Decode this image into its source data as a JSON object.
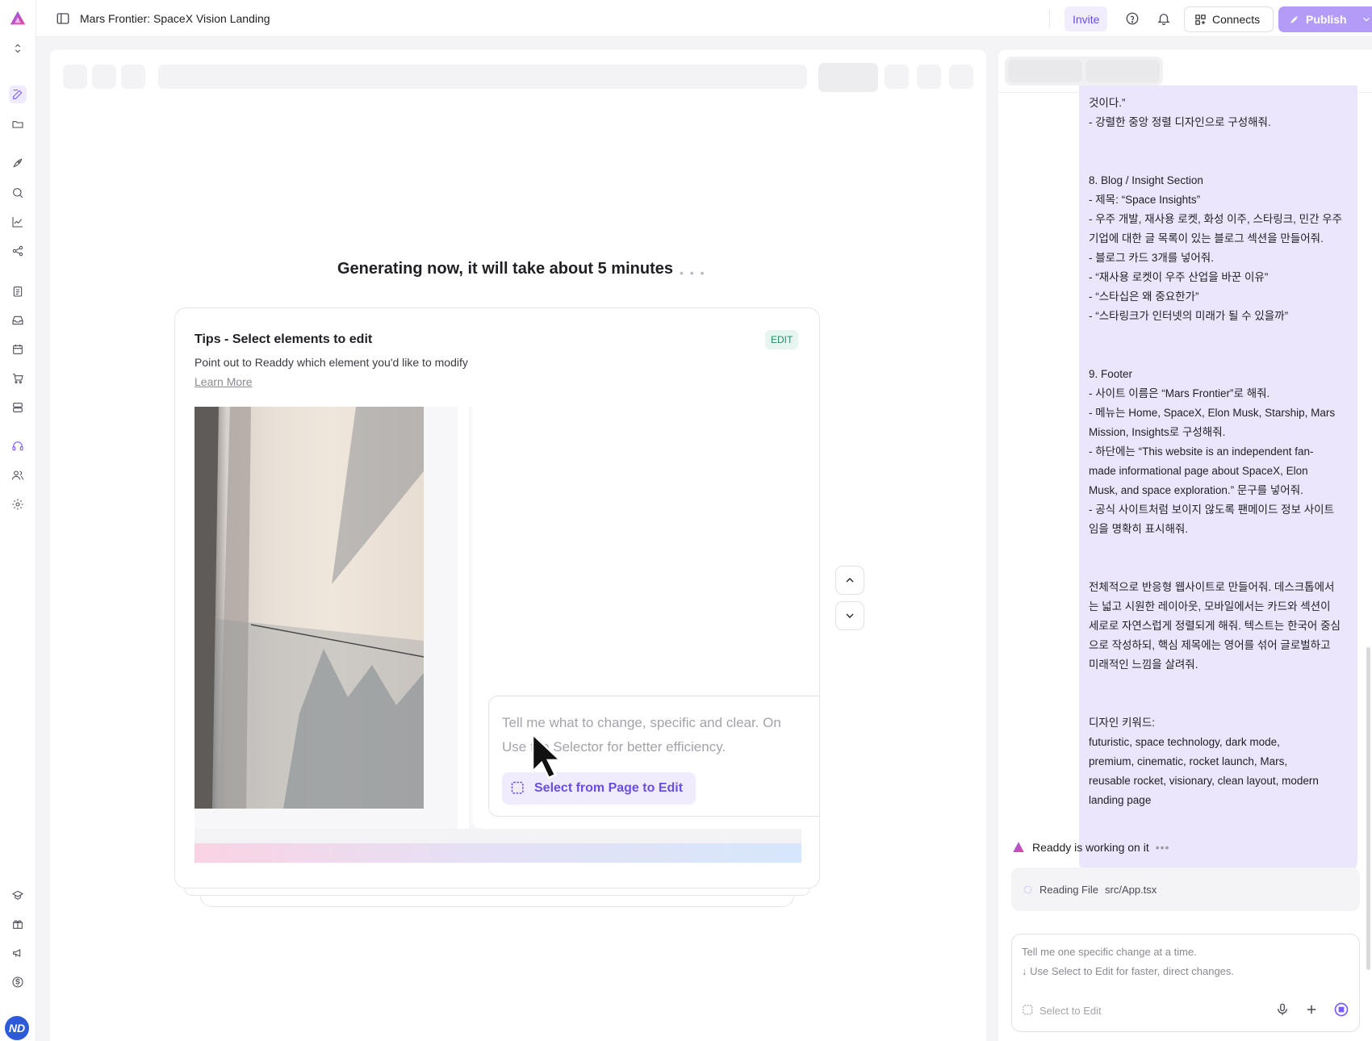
{
  "app": {
    "project_title": "Mars Frontier: SpaceX Vision Landing",
    "accent_color": "#7a5af8",
    "user_initials": "ND"
  },
  "topbar": {
    "invite_label": "Invite",
    "connects_label": "Connects",
    "publish_label": "Publish"
  },
  "sidebar": {
    "icons": [
      "logo-icon",
      "expand-icon",
      "edit-icon",
      "folder-icon",
      "rocket-icon",
      "search-chat-icon",
      "analytics-icon",
      "share-icon",
      "clipboard-icon",
      "inbox-icon",
      "calendar-icon",
      "cart-icon",
      "database-icon",
      "support-icon",
      "users-icon",
      "settings-icon",
      "shield-icon",
      "gift-icon",
      "megaphone-icon",
      "dollar-icon"
    ]
  },
  "canvas": {
    "status_text": "Generating now, it will take about 5 minutes",
    "tips": {
      "title": "Tips - Select elements to edit",
      "badge": "EDIT",
      "description": "Point out to Readdy which element you'd like to modify",
      "learn_more": "Learn More",
      "demo_prompt_line1": "Tell me what to change, specific and clear. On",
      "demo_prompt_line2": "Use the Selector for better efficiency.",
      "demo_select_button": "Select from Page to Edit"
    }
  },
  "chat": {
    "message_lines": [
      "것이다.”",
      "- 강렬한 중앙 정렬 디자인으로 구성해줘.",
      "",
      "",
      "8. Blog / Insight Section",
      "- 제목: “Space Insights”",
      "- 우주 개발, 재사용 로켓, 화성 이주, 스타링크, 민간 우주",
      "기업에 대한 글 목록이 있는 블로그 섹션을 만들어줘.",
      "- 블로그 카드 3개를 넣어줘.",
      "  - “재사용 로켓이 우주 산업을 바꾼 이유”",
      "  - “스타십은 왜 중요한가”",
      "  - “스타링크가 인터넷의 미래가 될 수 있을까”",
      "",
      "",
      "9. Footer",
      "- 사이트 이름은 “Mars Frontier”로 해줘.",
      "- 메뉴는 Home, SpaceX, Elon Musk, Starship, Mars",
      "Mission, Insights로 구성해줘.",
      "- 하단에는 “This website is an independent fan-",
      "made informational page about SpaceX, Elon",
      "Musk, and space exploration.” 문구를 넣어줘.",
      "- 공식 사이트처럼 보이지 않도록 팬메이드 정보 사이트",
      "임을 명확히 표시해줘.",
      "",
      "",
      "전체적으로 반응형 웹사이트로 만들어줘. 데스크톱에서",
      "는 넓고 시원한 레이아웃, 모바일에서는 카드와 섹션이",
      "세로로 자연스럽게 정렬되게 해줘. 텍스트는 한국어 중심",
      "으로 작성하되, 핵심 제목에는 영어를 섞어 글로벌하고",
      "미래적인 느낌을 살려줘.",
      "",
      "",
      "디자인 키워드:",
      "futuristic, space technology, dark mode,",
      "premium, cinematic, rocket launch, Mars,",
      "reusable rocket, visionary, clean layout, modern",
      "landing page"
    ],
    "working_text": "Readdy is working on it",
    "reading_label": "Reading File",
    "reading_file": "src/App.tsx",
    "input_placeholder_line1": "Tell me one specific change at a time.",
    "input_placeholder_line2": "↓ Use Select to Edit for faster, direct changes.",
    "select_to_edit": "Select to Edit"
  }
}
